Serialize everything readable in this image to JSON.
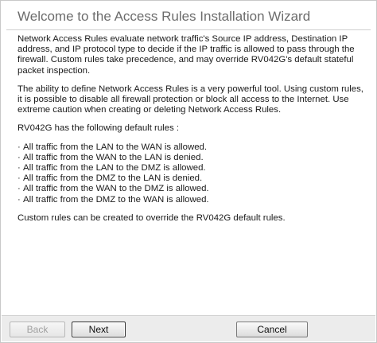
{
  "wizard": {
    "title": "Welcome to the Access Rules Installation Wizard",
    "paragraphs": [
      "Network Access Rules evaluate network traffic's Source IP address, Destination IP address, and IP protocol type to decide if the IP traffic is allowed to pass through the firewall. Custom rules take precedence, and may override RV042G's default stateful packet inspection.",
      "The ability to define Network Access Rules is a very powerful tool. Using custom rules, it is possible to disable all firewall protection or block all access to the Internet. Use extreme caution when creating or deleting Network Access Rules.",
      "RV042G has the following default rules :"
    ],
    "default_rules": [
      "All traffic from the LAN to the WAN is allowed.",
      "All traffic from the WAN to the LAN is denied.",
      "All traffic from the LAN to the DMZ is allowed.",
      "All traffic from the DMZ to the LAN is denied.",
      "All traffic from the WAN to the DMZ is allowed.",
      "All traffic from the DMZ to the WAN is allowed."
    ],
    "closing": "Custom rules can be created to override the RV042G default rules."
  },
  "footer": {
    "back_label": "Back",
    "next_label": "Next",
    "cancel_label": "Cancel"
  }
}
